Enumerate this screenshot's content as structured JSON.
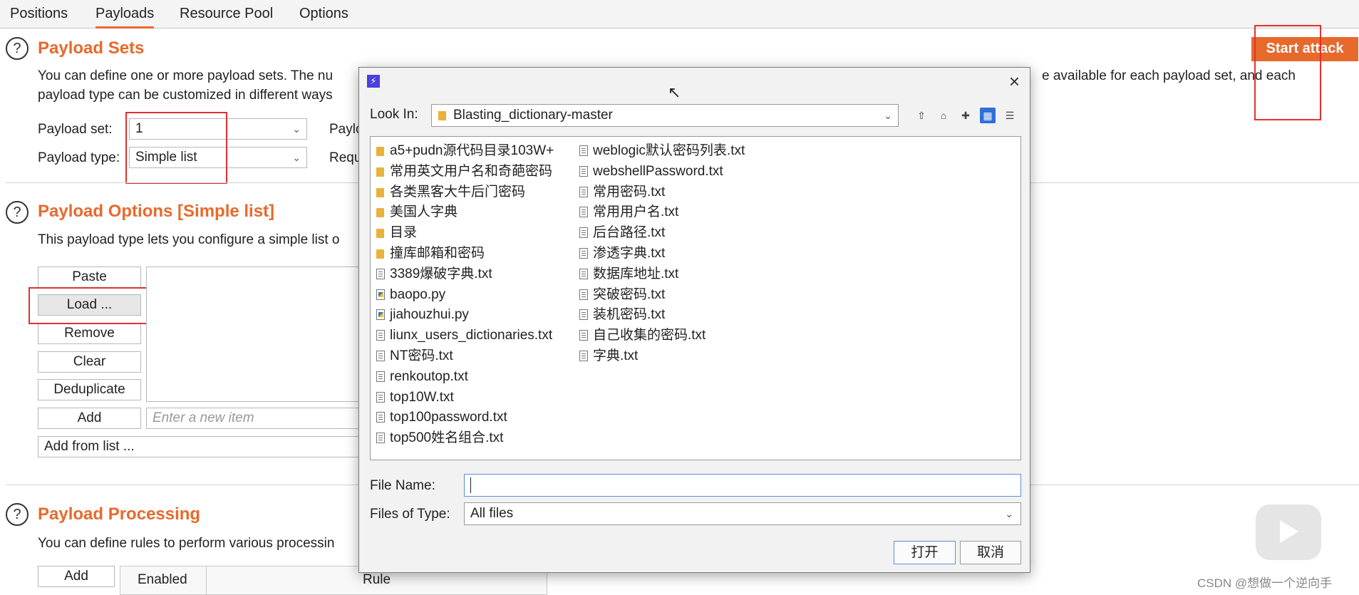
{
  "tabs": [
    "Positions",
    "Payloads",
    "Resource Pool",
    "Options"
  ],
  "active_tab": "Payloads",
  "payload_sets": {
    "title": "Payload Sets",
    "desc_line1_left": "You can define one or more payload sets. The nu",
    "desc_line1_right": "e available for each payload set, and each",
    "desc_line2": "payload type can be customized in different ways",
    "set_label": "Payload set:",
    "set_value": "1",
    "type_label": "Payload type:",
    "type_value": "Simple list",
    "count_label_partial": "Paylo",
    "request_label_partial": "Requ",
    "start_attack": "Start attack"
  },
  "payload_options": {
    "title": "Payload Options [Simple list]",
    "desc": "This payload type lets you configure a simple list o",
    "buttons": [
      "Paste",
      "Load ...",
      "Remove",
      "Clear",
      "Deduplicate",
      "Add"
    ],
    "new_item_placeholder": "Enter a new item",
    "add_from_list": "Add from list ..."
  },
  "payload_processing": {
    "title": "Payload Processing",
    "desc": "You can define rules to perform various processin",
    "add_button": "Add",
    "col_enabled": "Enabled",
    "col_rule": "Rule"
  },
  "dialog": {
    "icon": "burp-icon",
    "look_in_label": "Look In:",
    "look_in_value": "Blasting_dictionary-master",
    "files_col1": [
      {
        "name": "a5+pudn源代码目录103W+",
        "kind": "folder"
      },
      {
        "name": "常用英文用户名和奇葩密码",
        "kind": "folder"
      },
      {
        "name": "各类黑客大牛后门密码",
        "kind": "folder"
      },
      {
        "name": "美国人字典",
        "kind": "folder"
      },
      {
        "name": "目录",
        "kind": "folder"
      },
      {
        "name": "撞库邮箱和密码",
        "kind": "folder"
      },
      {
        "name": "3389爆破字典.txt",
        "kind": "doc"
      },
      {
        "name": "baopo.py",
        "kind": "py"
      },
      {
        "name": "jiahouzhui.py",
        "kind": "py"
      },
      {
        "name": "liunx_users_dictionaries.txt",
        "kind": "doc"
      },
      {
        "name": "NT密码.txt",
        "kind": "doc"
      },
      {
        "name": "renkoutop.txt",
        "kind": "doc"
      },
      {
        "name": "top10W.txt",
        "kind": "doc"
      },
      {
        "name": "top100password.txt",
        "kind": "doc"
      },
      {
        "name": "top500姓名组合.txt",
        "kind": "doc"
      }
    ],
    "files_col2": [
      {
        "name": "weblogic默认密码列表.txt",
        "kind": "doc"
      },
      {
        "name": "webshellPassword.txt",
        "kind": "doc"
      },
      {
        "name": "常用密码.txt",
        "kind": "doc"
      },
      {
        "name": "常用用户名.txt",
        "kind": "doc"
      },
      {
        "name": "后台路径.txt",
        "kind": "doc"
      },
      {
        "name": "渗透字典.txt",
        "kind": "doc"
      },
      {
        "name": "数据库地址.txt",
        "kind": "doc"
      },
      {
        "name": "突破密码.txt",
        "kind": "doc"
      },
      {
        "name": "装机密码.txt",
        "kind": "doc"
      },
      {
        "name": "自己收集的密码.txt",
        "kind": "doc"
      },
      {
        "name": "字典.txt",
        "kind": "doc"
      }
    ],
    "file_name_label": "File Name:",
    "file_name_value": "",
    "files_of_type_label": "Files of Type:",
    "files_of_type_value": "All files",
    "open_button": "打开",
    "cancel_button": "取消"
  },
  "watermark": "CSDN @想做一个逆向手"
}
